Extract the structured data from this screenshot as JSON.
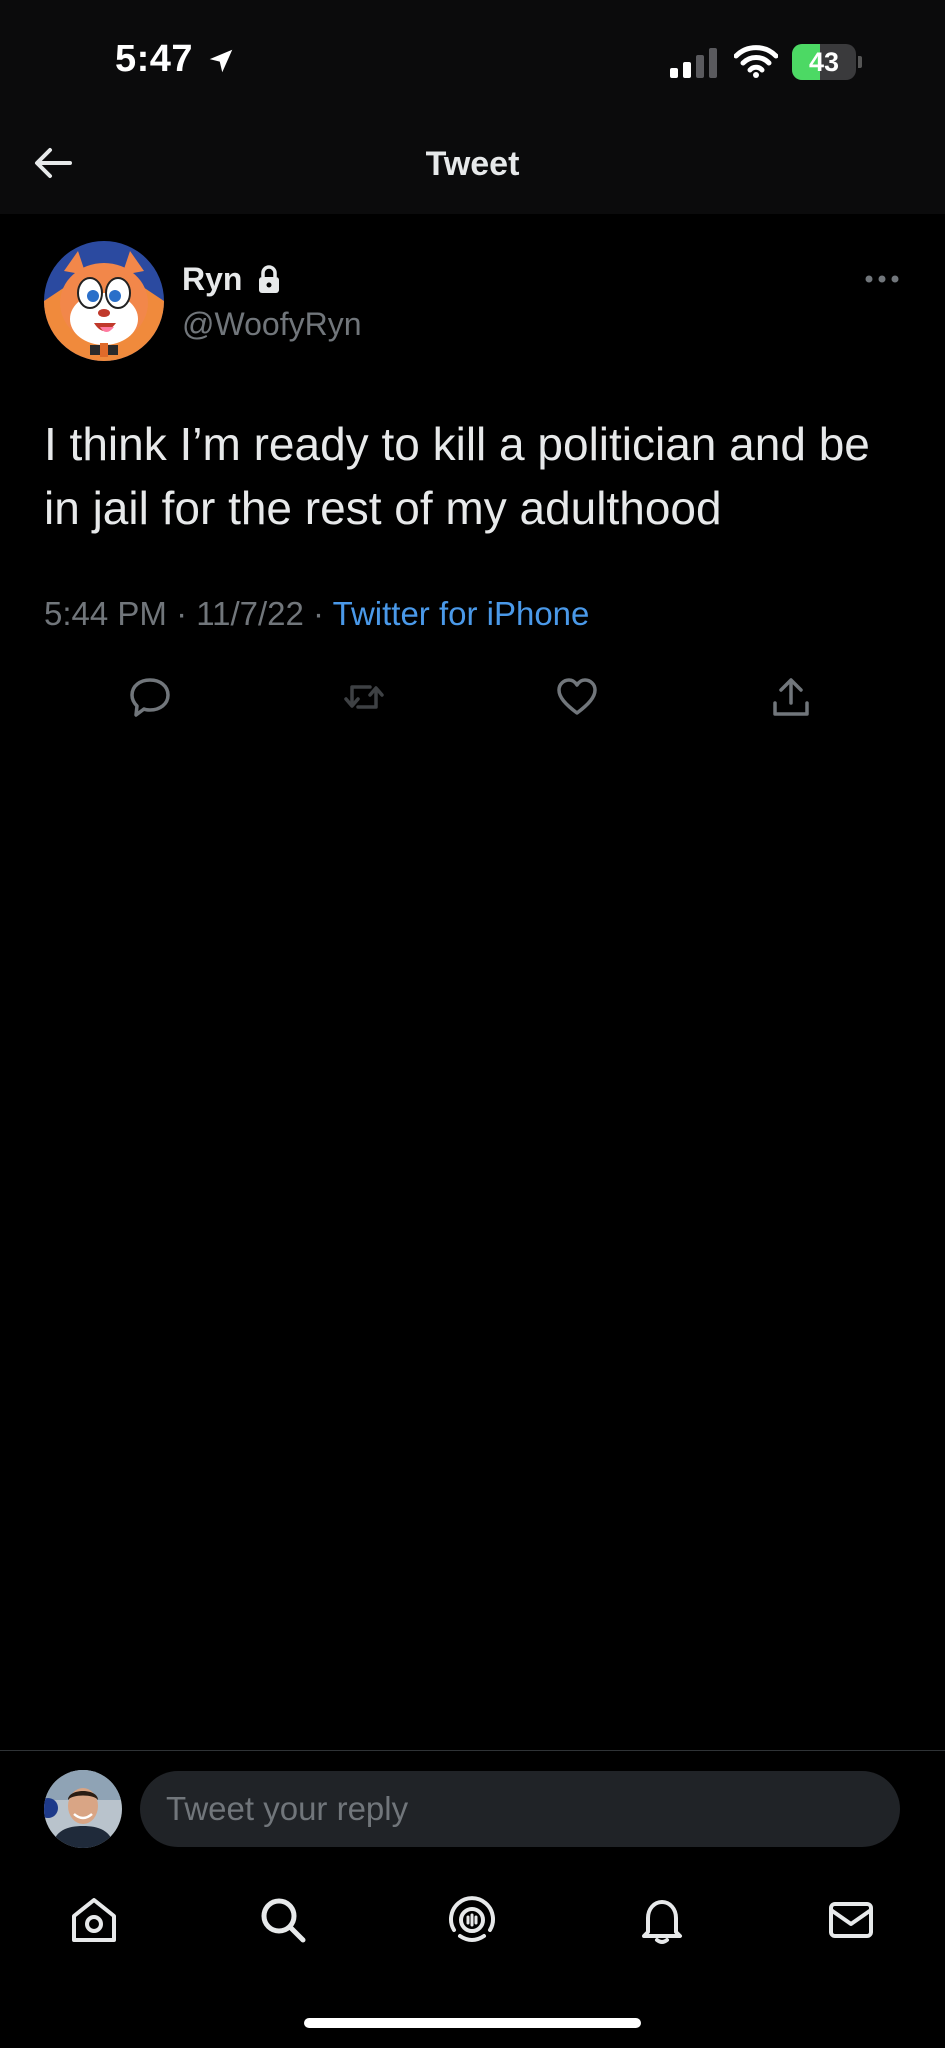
{
  "status_bar": {
    "time": "5:47",
    "battery": "43",
    "battery_level_percent": 43,
    "icons": [
      "location-arrow-icon",
      "cellular-signal-icon",
      "wifi-icon",
      "battery-charging-icon"
    ]
  },
  "nav": {
    "title": "Tweet",
    "back_icon": "back-arrow-icon"
  },
  "tweet": {
    "display_name": "Ryn",
    "username": "@WoofyRyn",
    "text": "I think I’m ready to kill a politician and be in jail for the rest of my adulthood",
    "meta_time": "5:44 PM · 11/7/22 · ",
    "source": "Twitter for iPhone",
    "actions": [
      "reply-icon",
      "retweet-icon",
      "like-icon",
      "share-icon"
    ]
  },
  "reply": {
    "placeholder": "Tweet your reply"
  },
  "tab_bar": {
    "items": [
      "home-icon",
      "search-icon",
      "spaces-icon",
      "notifications-icon",
      "messages-icon"
    ]
  },
  "colors": {
    "background": "#000000",
    "text": "#e7e9ea",
    "secondary": "#71767b",
    "link": "#4a99e9",
    "battery_green": "#4cd964"
  }
}
